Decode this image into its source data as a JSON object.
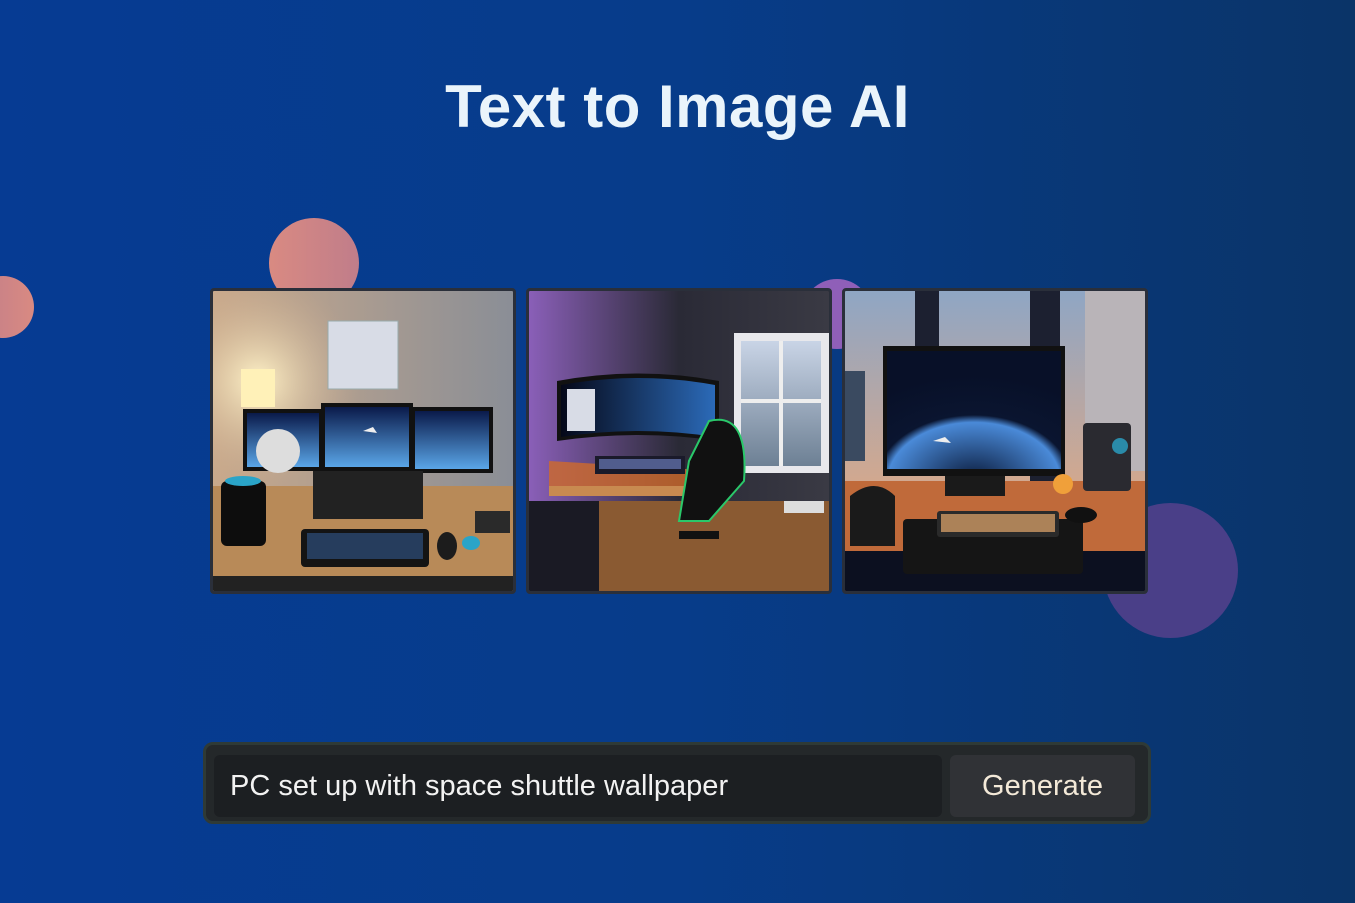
{
  "header": {
    "title": "Text to Image AI"
  },
  "gallery": {
    "images": [
      {
        "name": "generated-image-1",
        "subject": "triple-monitor desk setup with space shuttle wallpaper"
      },
      {
        "name": "generated-image-2",
        "subject": "curved monitor gaming desk by window with space wallpaper"
      },
      {
        "name": "generated-image-3",
        "subject": "single monitor desk by city window with space shuttle wallpaper"
      }
    ]
  },
  "prompt": {
    "value": "PC set up with space shuttle wallpaper",
    "button_label": "Generate"
  },
  "colors": {
    "background_start": "#063b93",
    "background_end": "#0a3468",
    "title": "#eaf4fb",
    "button_text": "#f3e9d8"
  }
}
